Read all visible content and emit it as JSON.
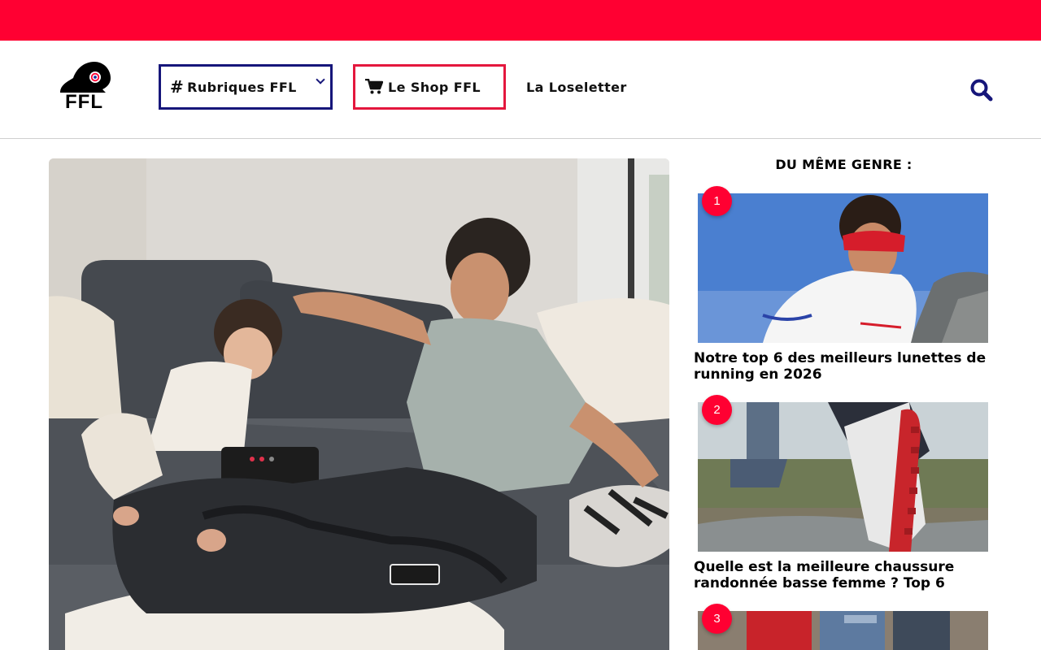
{
  "brand": {
    "logo_text": "FFL",
    "accent": "#ff0032",
    "navy": "#16167a",
    "shop_red": "#e4173d"
  },
  "nav": {
    "rubriques_label": "Rubriques FFL",
    "rubriques_icon": "hash-icon",
    "shop_label": "Le Shop FFL",
    "shop_icon": "cart-icon",
    "newsletter_label": "La Loseletter",
    "search_icon": "search-icon"
  },
  "hero": {
    "image": "father-and-child-on-sofa-wearing-compression-boots"
  },
  "sidebar": {
    "title": "DU MÊME GENRE :",
    "items": [
      {
        "rank": "1",
        "title": "Notre top 6 des meilleurs lunettes de running en 2026",
        "image": "runner-with-red-sunglasses"
      },
      {
        "rank": "2",
        "title": "Quelle est la meilleure chaussure randonnée basse femme ? Top 6",
        "image": "hiking-shoe-in-puddle"
      },
      {
        "rank": "3",
        "title": "",
        "image": "hikers-with-backpacks"
      }
    ]
  }
}
